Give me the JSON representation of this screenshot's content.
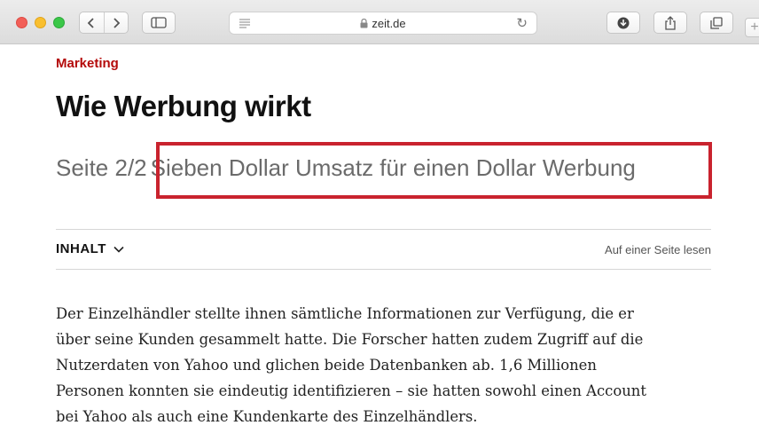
{
  "browser": {
    "url": "zeit.de"
  },
  "article": {
    "kicker": "Marketing",
    "title": "Wie Werbung wirkt",
    "page_indicator": "Seite 2/2",
    "subtitle": "Sieben Dollar Umsatz für einen Dollar Werbung",
    "toc_label": "INHALT",
    "single_page_link": "Auf einer Seite lesen",
    "body_lines": [
      "Der Einzelhändler stellte ihnen sämtliche Informationen zur Verfügung, die er",
      "über seine Kunden gesammelt hatte. Die Forscher hatten zudem Zugriff auf die",
      "Nutzerdaten von Yahoo und glichen beide Datenbanken ab. 1,6 Millionen",
      "Personen konnten sie eindeutig identifizieren – sie hatten sowohl einen Account",
      "bei Yahoo als auch eine Kundenkarte des Einzelhändlers."
    ]
  },
  "colors": {
    "kicker_red": "#b40a0a",
    "highlight_red": "#c9232e"
  }
}
